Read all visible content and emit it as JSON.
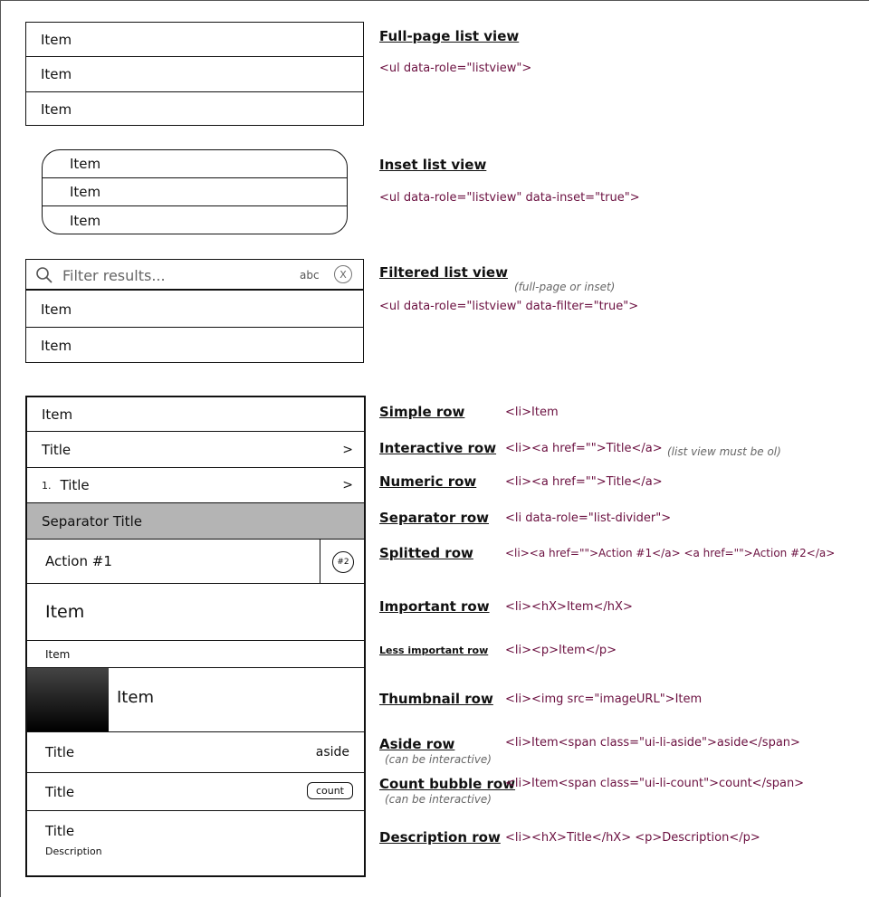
{
  "full_page": {
    "items": [
      "Item",
      "Item",
      "Item"
    ],
    "heading": "Full-page list view",
    "code": "<ul data-role=\"listview\">"
  },
  "inset": {
    "items": [
      "Item",
      "Item",
      "Item"
    ],
    "heading": "Inset list view",
    "code": "<ul data-role=\"listview\" data-inset=\"true\">"
  },
  "filtered": {
    "placeholder": "Filter results...",
    "keyboard": "abc",
    "clear": "X",
    "items": [
      "Item",
      "Item"
    ],
    "heading": "Filtered list view",
    "note": "(full-page or inset)",
    "code": "<ul data-role=\"listview\" data-filter=\"true\">"
  },
  "rows": {
    "simple": {
      "text": "Item",
      "heading": "Simple row",
      "code": "<li>Item"
    },
    "interactive": {
      "text": "Title",
      "chev": ">",
      "heading": "Interactive row",
      "code": "<li><a href=\"\">Title</a>",
      "note": "(list view must be ol)"
    },
    "numeric": {
      "num": "1.",
      "text": "Title",
      "chev": ">",
      "heading": "Numeric row",
      "code": "<li><a href=\"\">Title</a>"
    },
    "separator": {
      "text": "Separator Title",
      "heading": "Separator row",
      "code": "<li data-role=\"list-divider\">"
    },
    "splitted": {
      "text": "Action #1",
      "badge": "#2",
      "heading": "Splitted row",
      "code": "<li><a href=\"\">Action #1</a> <a href=\"\">Action #2</a>"
    },
    "important": {
      "text": "Item",
      "heading": "Important row",
      "code": "<li><hX>Item</hX>"
    },
    "less": {
      "text": "Item",
      "heading": "Less important row",
      "code": "<li><p>Item</p>"
    },
    "thumbnail": {
      "text": "Item",
      "heading": "Thumbnail row",
      "code": "<li><img src=\"imageURL\">Item"
    },
    "aside": {
      "text": "Title",
      "aside": "aside",
      "heading": "Aside row",
      "note": "(can be interactive)",
      "code": "<li>Item<span class=\"ui-li-aside\">aside</span>"
    },
    "count": {
      "text": "Title",
      "count": "count",
      "heading": "Count bubble row",
      "note": "(can be interactive)",
      "code": "<li>Item<span class=\"ui-li-count\">count</span>"
    },
    "description": {
      "title": "Title",
      "desc": "Description",
      "heading": "Description row",
      "code": "<li><hX>Title</hX> <p>Description</p>"
    }
  }
}
